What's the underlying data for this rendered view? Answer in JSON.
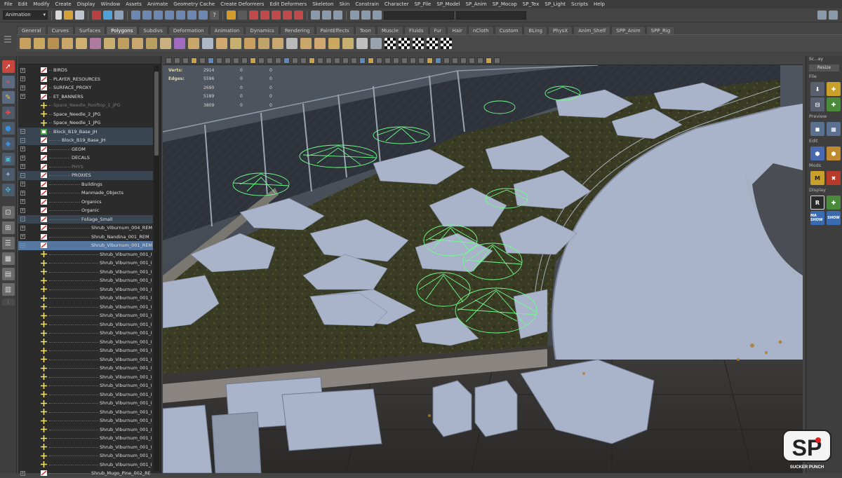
{
  "menu": [
    "File",
    "Edit",
    "Modify",
    "Create",
    "Display",
    "Window",
    "Assets",
    "Animate",
    "Geometry Cache",
    "Create Deformers",
    "Edit Deformers",
    "Skeleton",
    "Skin",
    "Constrain",
    "Character",
    "SP_File",
    "SP_Model",
    "SP_Anim",
    "SP_Mocap",
    "SP_Tex",
    "SP_Light",
    "Scripts",
    "Help"
  ],
  "status": {
    "mode": "Animation"
  },
  "shelf_tabs": [
    "General",
    "Curves",
    "Surfaces",
    "Polygons",
    "Subdivs",
    "Deformation",
    "Animation",
    "Dynamics",
    "Rendering",
    "PaintEffects",
    "Toon",
    "Muscle",
    "Fluids",
    "Fur",
    "Hair",
    "nCloth",
    "Custom",
    "BLing",
    "PhysX",
    "Anim_Shelf",
    "SPP_Anim",
    "SPP_Rig"
  ],
  "active_shelf": "Polygons",
  "hud": [
    {
      "label": "Verts:",
      "v": "2914",
      "a": "0",
      "b": "0"
    },
    {
      "label": "Edges:",
      "v": "5596",
      "a": "0",
      "b": "0"
    },
    {
      "label": "",
      "v": "2690",
      "a": "0",
      "b": "0"
    },
    {
      "label": "",
      "v": "5189",
      "a": "0",
      "b": "0"
    },
    {
      "label": "",
      "v": "3809",
      "a": "0",
      "b": "0"
    }
  ],
  "outliner": [
    {
      "label": "BIRDS",
      "indent": 0,
      "icon": "mesh",
      "exp": "+"
    },
    {
      "label": "PLAYER_RESOURCES",
      "indent": 0,
      "icon": "mesh",
      "exp": "+"
    },
    {
      "label": "SURFACE_PROXY",
      "indent": 0,
      "icon": "mesh",
      "exp": "+"
    },
    {
      "label": "ET_BANNERS",
      "indent": 0,
      "icon": "mesh",
      "exp": "+"
    },
    {
      "label": "Space_Needle_Rooftop_1_JPG",
      "indent": 0,
      "icon": "cross",
      "exp": "",
      "dim": true
    },
    {
      "label": "Space_Needle_2_JPG",
      "indent": 0,
      "icon": "cross",
      "exp": ""
    },
    {
      "label": "Space_Needle_1_JPG",
      "indent": 0,
      "icon": "cross",
      "exp": ""
    },
    {
      "label": "Block_B19_Base_JH",
      "indent": 0,
      "icon": "group",
      "exp": "−",
      "hl": true
    },
    {
      "label": "Block_B19_Base_JH",
      "indent": 1,
      "icon": "mesh",
      "exp": "−",
      "hl": true
    },
    {
      "label": "GEOM",
      "indent": 2,
      "icon": "mesh",
      "exp": "+"
    },
    {
      "label": "DECALS",
      "indent": 2,
      "icon": "mesh",
      "exp": "+"
    },
    {
      "label": "PHYS",
      "indent": 2,
      "icon": "mesh",
      "exp": "+",
      "dim": true
    },
    {
      "label": "PROXIES",
      "indent": 2,
      "icon": "mesh",
      "exp": "−",
      "hl": true
    },
    {
      "label": "Buildings",
      "indent": 3,
      "icon": "mesh",
      "exp": "+"
    },
    {
      "label": "Manmade_Objects",
      "indent": 3,
      "icon": "mesh",
      "exp": "+"
    },
    {
      "label": "Organics",
      "indent": 3,
      "icon": "mesh",
      "exp": "+"
    },
    {
      "label": "Organic",
      "indent": 3,
      "icon": "mesh",
      "exp": "+"
    },
    {
      "label": "Foliage_Small",
      "indent": 3,
      "icon": "mesh",
      "exp": "−",
      "hl": true
    },
    {
      "label": "Shrub_Viburnum_004_REM",
      "indent": 4,
      "icon": "mesh",
      "exp": "+"
    },
    {
      "label": "Shrub_Nandina_001_REM",
      "indent": 4,
      "icon": "mesh",
      "exp": "+"
    },
    {
      "label": "Shrub_Viburnum_001_REM",
      "indent": 4,
      "icon": "mesh",
      "exp": "−",
      "sel": true
    },
    {
      "label": "Shrub_Viburnum_001_I",
      "indent": 5,
      "icon": "cross",
      "exp": ""
    },
    {
      "label": "Shrub_Viburnum_001_I",
      "indent": 5,
      "icon": "cross",
      "exp": ""
    },
    {
      "label": "Shrub_Viburnum_001_I",
      "indent": 5,
      "icon": "cross",
      "exp": ""
    },
    {
      "label": "Shrub_Viburnum_001_I",
      "indent": 5,
      "icon": "cross",
      "exp": ""
    },
    {
      "label": "Shrub_Viburnum_001_I",
      "indent": 5,
      "icon": "cross",
      "exp": ""
    },
    {
      "label": "Shrub_Viburnum_001_I",
      "indent": 5,
      "icon": "cross",
      "exp": ""
    },
    {
      "label": "Shrub_Viburnum_001_I",
      "indent": 5,
      "icon": "cross",
      "exp": ""
    },
    {
      "label": "Shrub_Viburnum_001_I",
      "indent": 5,
      "icon": "cross",
      "exp": ""
    },
    {
      "label": "Shrub_Viburnum_001_I",
      "indent": 5,
      "icon": "cross",
      "exp": ""
    },
    {
      "label": "Shrub_Viburnum_001_I",
      "indent": 5,
      "icon": "cross",
      "exp": ""
    },
    {
      "label": "Shrub_Viburnum_001_I",
      "indent": 5,
      "icon": "cross",
      "exp": ""
    },
    {
      "label": "Shrub_Viburnum_001_I",
      "indent": 5,
      "icon": "cross",
      "exp": ""
    },
    {
      "label": "Shrub_Viburnum_001_I",
      "indent": 5,
      "icon": "cross",
      "exp": ""
    },
    {
      "label": "Shrub_Viburnum_001_I",
      "indent": 5,
      "icon": "cross",
      "exp": ""
    },
    {
      "label": "Shrub_Viburnum_001_I",
      "indent": 5,
      "icon": "cross",
      "exp": ""
    },
    {
      "label": "Shrub_Viburnum_001_I",
      "indent": 5,
      "icon": "cross",
      "exp": ""
    },
    {
      "label": "Shrub_Viburnum_001_I",
      "indent": 5,
      "icon": "cross",
      "exp": ""
    },
    {
      "label": "Shrub_Viburnum_001_I",
      "indent": 5,
      "icon": "cross",
      "exp": ""
    },
    {
      "label": "Shrub_Viburnum_001_I",
      "indent": 5,
      "icon": "cross",
      "exp": ""
    },
    {
      "label": "Shrub_Viburnum_001_I",
      "indent": 5,
      "icon": "cross",
      "exp": ""
    },
    {
      "label": "Shrub_Viburnum_001_I",
      "indent": 5,
      "icon": "cross",
      "exp": ""
    },
    {
      "label": "Shrub_Viburnum_001_I",
      "indent": 5,
      "icon": "cross",
      "exp": ""
    },
    {
      "label": "Shrub_Viburnum_001_I",
      "indent": 5,
      "icon": "cross",
      "exp": ""
    },
    {
      "label": "Shrub_Viburnum_001_I",
      "indent": 5,
      "icon": "cross",
      "exp": ""
    },
    {
      "label": "Shrub_Viburnum_001_I",
      "indent": 5,
      "icon": "cross",
      "exp": ""
    },
    {
      "label": "Shrub_Mugo_Pine_002_RE",
      "indent": 4,
      "icon": "mesh",
      "exp": "+"
    }
  ],
  "right_shelf": {
    "title": "Sc...ey",
    "resize": "Resize",
    "sections": [
      "File",
      "Preview",
      "Edit",
      "Mods",
      "Display"
    ],
    "mods_label": "M",
    "display_label": "R",
    "show1": "MA\nSHOW",
    "show2": "SHOW"
  },
  "logo": {
    "text": "SP",
    "sub": "SUCKER PUNCH"
  },
  "colors": {
    "wire": "#6dff8a",
    "proxy": "#a9b3c9",
    "ground": "#3a3b24",
    "selection": "#5677a0"
  }
}
